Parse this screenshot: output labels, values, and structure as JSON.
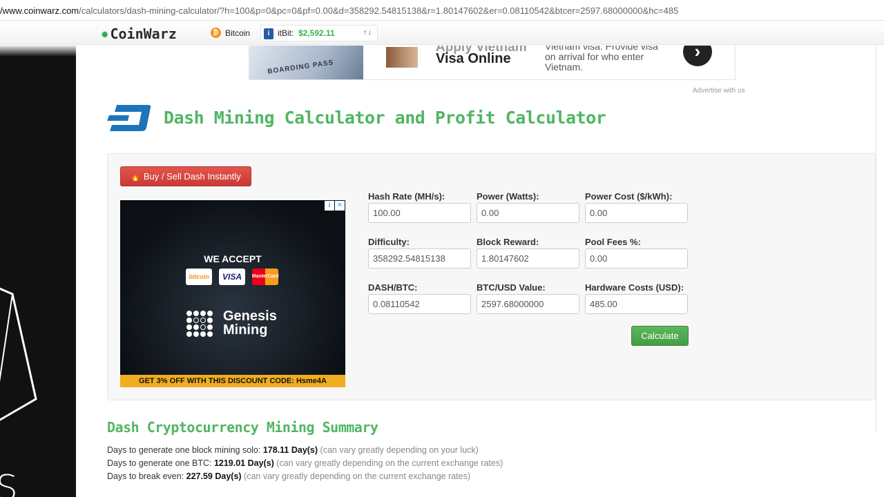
{
  "browser": {
    "url_host": "/www.coinwarz.com",
    "url_rest": "/calculators/dash-mining-calculator/?h=100&p=0&pc=0&pf=0.00&d=358292.54815138&r=1.80147602&er=0.08110542&btcer=2597.68000000&hc=485"
  },
  "topnav": {
    "logo_text": "CoinWarz",
    "coin_label": "Bitcoin",
    "ticker_exchange": "itBit:",
    "ticker_price": "$2,592.11",
    "ticker_arrows": "↑↓"
  },
  "top_ad": {
    "headline_faded": "Apply Vietnam",
    "headline": "Visa Online",
    "body": "Vietnam visa. Provide visa on arrival for who enter Vietnam.",
    "photo_text": "BOARDING PASS",
    "arrow_glyph": "›"
  },
  "advertise_link": "Advertise with us",
  "page_title": "Dash Mining Calculator and Profit Calculator",
  "buy_button": "Buy / Sell Dash Instantly",
  "square_ad": {
    "accept": "WE ACCEPT",
    "card_btc": "bitcoin",
    "card_visa": "VISA",
    "card_mc": "MasterCard",
    "brand_line1": "Genesis",
    "brand_line2": "Mining",
    "discount": "GET 3% OFF WITH THIS DISCOUNT CODE: Hsme4A"
  },
  "form": {
    "hash_rate": {
      "label": "Hash Rate (MH/s):",
      "value": "100.00"
    },
    "power": {
      "label": "Power (Watts):",
      "value": "0.00"
    },
    "power_cost": {
      "label": "Power Cost ($/kWh):",
      "value": "0.00"
    },
    "difficulty": {
      "label": "Difficulty:",
      "value": "358292.54815138"
    },
    "block_reward": {
      "label": "Block Reward:",
      "value": "1.80147602"
    },
    "pool_fees": {
      "label": "Pool Fees %:",
      "value": "0.00"
    },
    "dash_btc": {
      "label": "DASH/BTC:",
      "value": "0.08110542"
    },
    "btc_usd": {
      "label": "BTC/USD Value:",
      "value": "2597.68000000"
    },
    "hardware_costs": {
      "label": "Hardware Costs (USD):",
      "value": "485.00"
    },
    "calculate_label": "Calculate"
  },
  "summary": {
    "title": "Dash Cryptocurrency Mining Summary",
    "lines": [
      {
        "label": "Days to generate one block mining solo: ",
        "value": "178.11 Day(s)",
        "note": " (can vary greatly depending on your luck)"
      },
      {
        "label": "Days to generate one BTC: ",
        "value": "1219.01 Day(s)",
        "note": " (can vary greatly depending on the current exchange rates)"
      },
      {
        "label": "Days to break even: ",
        "value": "227.59 Day(s)",
        "note": " (can vary greatly depending on the current exchange rates)"
      }
    ]
  },
  "side_panel": {
    "letter": "S"
  },
  "colors": {
    "accent_green": "#4fb661",
    "buy_red": "#d9534f",
    "calc_green": "#5cb85c",
    "dash_blue": "#1c75bc"
  }
}
